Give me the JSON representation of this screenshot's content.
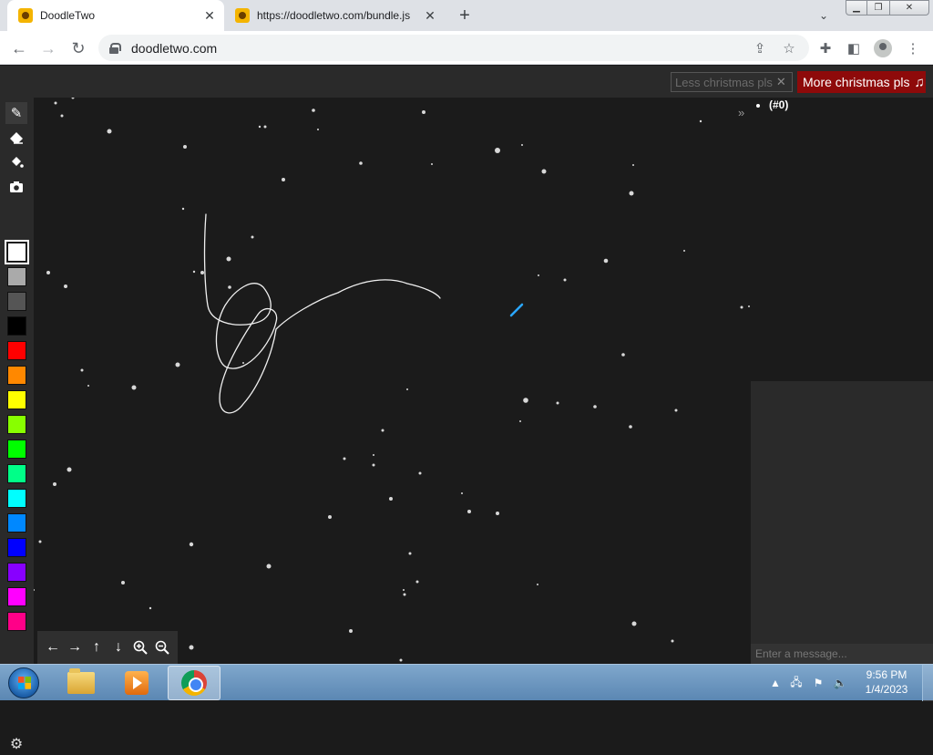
{
  "browser": {
    "tabs": [
      {
        "title": "DoodleTwo",
        "active": true
      },
      {
        "title": "https://doodletwo.com/bundle.js",
        "active": false
      }
    ],
    "url": "doodletwo.com"
  },
  "app": {
    "less_christmas_label": "Less christmas pls",
    "more_christmas_label": "More christmas pls",
    "users": [
      "(#0)"
    ],
    "chat_placeholder": "Enter a message...",
    "tools": [
      "pencil-icon",
      "eraser-icon",
      "fill-bucket-icon",
      "camera-icon"
    ],
    "palette": [
      "#ffffff",
      "#aaaaaa",
      "#555555",
      "#000000",
      "#ff0000",
      "#ff8800",
      "#ffff00",
      "#88ff00",
      "#00ff00",
      "#00ff88",
      "#00ffff",
      "#0088ff",
      "#0000ff",
      "#8800ff",
      "#ff00ff",
      "#ff0088"
    ],
    "selected_color": "#ffffff",
    "nav_pad": [
      "arrow-left-icon",
      "arrow-right-icon",
      "arrow-up-icon",
      "arrow-down-icon",
      "zoom-in-icon",
      "zoom-out-icon"
    ]
  },
  "taskbar": {
    "time": "9:56 PM",
    "date": "1/4/2023"
  }
}
